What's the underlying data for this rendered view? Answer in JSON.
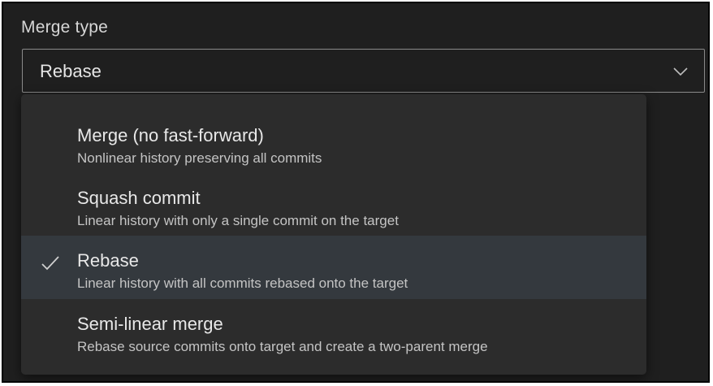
{
  "merge_type": {
    "label": "Merge type",
    "selected_value": "Rebase",
    "chevron_icon": "chevron-down-icon",
    "check_icon": "checkmark-icon",
    "options": [
      {
        "title": "Merge (no fast-forward)",
        "description": "Nonlinear history preserving all commits",
        "selected": false
      },
      {
        "title": "Squash commit",
        "description": "Linear history with only a single commit on the target",
        "selected": false
      },
      {
        "title": "Rebase",
        "description": "Linear history with all commits rebased onto the target",
        "selected": true
      },
      {
        "title": "Semi-linear merge",
        "description": "Rebase source commits onto target and create a two-parent merge",
        "selected": false
      }
    ]
  },
  "colors": {
    "background": "#1f1f1f",
    "dropdown_background": "#2c2c2c",
    "selected_option_background": "#34393e",
    "text_primary": "#e8e8e8",
    "text_secondary": "#c4c4c4",
    "field_border": "#8a8a8a"
  }
}
